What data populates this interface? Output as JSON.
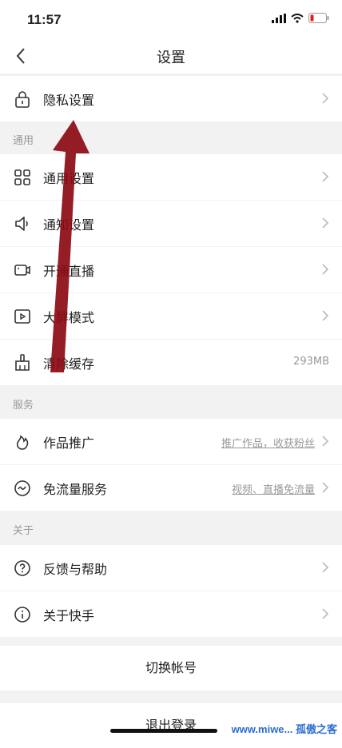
{
  "status": {
    "time": "11:57"
  },
  "nav": {
    "title": "设置"
  },
  "privacy": {
    "label": "隐私设置"
  },
  "sections": {
    "general": "通用",
    "service": "服务",
    "about": "关于"
  },
  "general_items": [
    {
      "label": "通用设置",
      "icon": "grid-icon"
    },
    {
      "label": "通知设置",
      "icon": "speaker-icon"
    },
    {
      "label": "开通直播",
      "icon": "camera-icon"
    },
    {
      "label": "大屏模式",
      "icon": "play-icon"
    },
    {
      "label": "清除缓存",
      "icon": "brush-icon",
      "value": "293MB"
    }
  ],
  "service_items": [
    {
      "label": "作品推广",
      "icon": "fire-icon",
      "value": "推广作品，收获粉丝"
    },
    {
      "label": "免流量服务",
      "icon": "wave-icon",
      "value": "视频、直播免流量"
    }
  ],
  "about_items": [
    {
      "label": "反馈与帮助",
      "icon": "help-icon"
    },
    {
      "label": "关于快手",
      "icon": "info-icon"
    }
  ],
  "actions": {
    "switch_account": "切换帐号",
    "logout": "退出登录"
  },
  "watermark": "www.miwe... 孤傲之客",
  "colors": {
    "arrow": "#8b0a14",
    "accent_text": "#999999"
  }
}
